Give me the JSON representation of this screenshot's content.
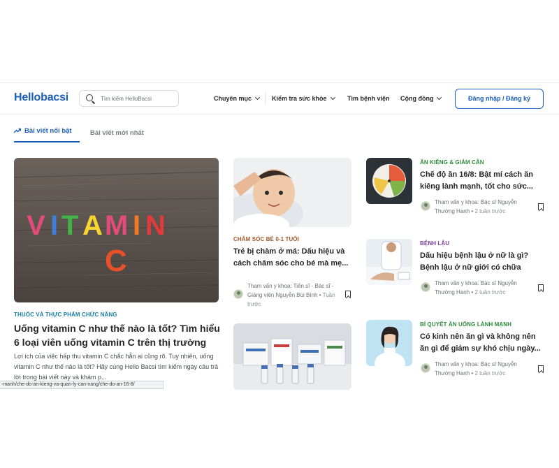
{
  "header": {
    "logo_prefix": "Hello",
    "logo_suffix": "bacsi",
    "search_placeholder": "Tìm kiếm HelloBacsi",
    "nav": [
      "Chuyên mục",
      "Kiểm tra sức khỏe",
      "Tìm bệnh viện",
      "Cộng đồng"
    ],
    "login_label": "Đăng nhập / Đăng ký"
  },
  "tabs": {
    "featured": "Bài viết nổi bật",
    "latest": "Bài viết mới nhất"
  },
  "colors": {
    "brand": "#1a5ebd",
    "cat_blue": "#1a7fa8",
    "cat_brown": "#a5582a",
    "cat_green": "#2e8a3e",
    "cat_purple": "#7b3fa0"
  },
  "main_article": {
    "image_text_line1": "VITAMIN",
    "image_text_line2": "C",
    "category": "THUỐC VÀ THỰC PHẨM CHỨC NĂNG",
    "title": "Uống vitamin C như thế nào là tốt? Tìm hiểu 6 loại viên uống vitamin C trên thị trường",
    "excerpt": "Lợi ích của việc hấp thu vitamin C chắc hẳn ai cũng rõ. Tuy nhiên, uống vitamin C như thế nào là tốt? Hãy cùng Hello Bacsi tìm kiếm ngay câu trả lời trong bài viết này và khám p..."
  },
  "middle_article": {
    "category": "CHĂM SÓC BÉ 0-1 TUỔI",
    "title": "Trẻ bị chàm ở má: Dấu hiệu và cách chăm sóc cho bé mà mẹ...",
    "meta": "Tham vấn y khoa: Tiến sĩ - Bác sĩ - Giảng viên Nguyễn Bùi Bình •",
    "time": "Tuần trước"
  },
  "side_articles": [
    {
      "category": "ĂN KIÊNG & GIẢM CÂN",
      "title": "Chế độ ăn 16/8: Bật mí cách ăn kiêng lành mạnh, tốt cho sức...",
      "meta": "Tham vấn y khoa: Bác sĩ Nguyễn Thường Hanh •",
      "time": "2 tuần trước"
    },
    {
      "category": "BỆNH LẬU",
      "title": "Dấu hiệu bệnh lậu ở nữ là gì? Bệnh lậu ở nữ giới có chữa được...",
      "meta": "Tham vấn y khoa: Bác sĩ Nguyễn Thường Hanh •",
      "time": "2 tuần trước"
    },
    {
      "category": "BÍ QUYẾT ĂN UỐNG LÀNH MẠNH",
      "title": "Có kinh nên ăn gì và không nên ăn gì để giảm sự khó chịu ngày...",
      "meta": "Tham vấn y khoa: Bác sĩ Nguyễn Thường Hanh •",
      "time": "2 tuần trước"
    }
  ],
  "status_url": "-manh/che-do-an-kieng-va-quan-ly-can-nang/che-do-an-16-8/"
}
